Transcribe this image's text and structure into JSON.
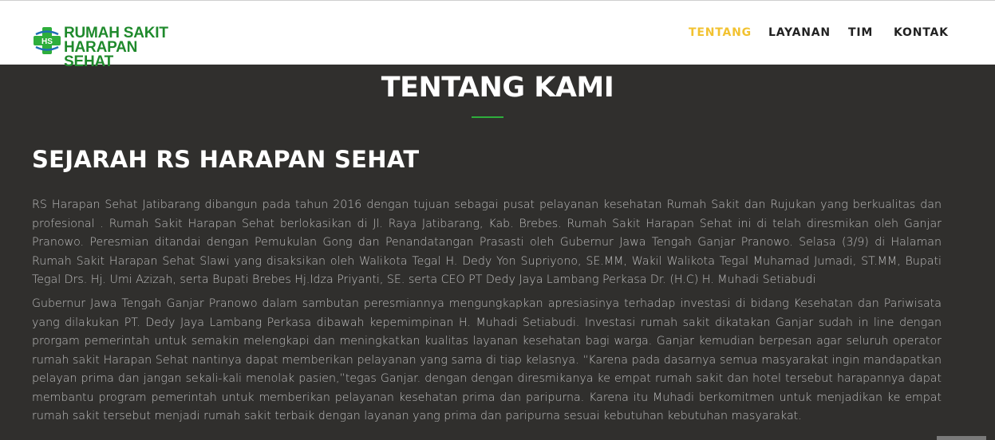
{
  "header": {
    "logo": {
      "line1": "RUMAH SAKIT",
      "line2": "HARAPAN SEHAT",
      "mark": "HS",
      "brand_color": "#1f8a2c"
    },
    "nav": [
      {
        "label": "TENTANG",
        "active": true
      },
      {
        "label": "LAYANAN",
        "active": false
      },
      {
        "label": "TIM",
        "active": false
      },
      {
        "label": "KONTAK",
        "active": false
      }
    ]
  },
  "section": {
    "title": "TENTANG KAMI",
    "heading": "SEJARAH RS HARAPAN SEHAT",
    "paragraphs": [
      "RS Harapan Sehat Jatibarang dibangun pada tahun 2016 dengan tujuan sebagai pusat pelayanan kesehatan Rumah Sakit dan Rujukan yang berkualitas dan profesional . Rumah Sakit Harapan Sehat berlokasikan di Jl. Raya Jatibarang, Kab. Brebes. Rumah Sakit Harapan Sehat ini di telah diresmikan oleh Ganjar Pranowo. Peresmian ditandai dengan Pemukulan Gong dan Penandatangan Prasasti oleh Gubernur Jawa Tengah Ganjar Pranowo. Selasa (3/9) di Halaman Rumah Sakit Harapan Sehat Slawi yang disaksikan oleh Walikota Tegal H. Dedy Yon Supriyono, SE.MM, Wakil Walikota Tegal Muhamad Jumadi, ST.MM, Bupati Tegal Drs. Hj. Umi Azizah, serta Bupati Brebes Hj.Idza Priyanti, SE. serta CEO PT Dedy Jaya Lambang Perkasa Dr. (H.C) H. Muhadi Setiabudi",
      "Gubernur Jawa Tengah Ganjar Pranowo dalam sambutan peresmiannya mengungkapkan apresiasinya terhadap investasi di bidang Kesehatan dan Pariwisata yang dilakukan PT. Dedy Jaya Lambang Perkasa dibawah kepemimpinan H. Muhadi Setiabudi. Investasi rumah sakit dikatakan Ganjar sudah in line dengan prorgam pemerintah untuk semakin melengkapi dan meningkatkan kualitas layanan kesehatan bagi warga. Ganjar kemudian berpesan agar seluruh operator rumah sakit Harapan Sehat nantinya dapat memberikan pelayanan yang sama di tiap kelasnya. “Karena pada dasarnya semua masyarakat ingin mandapatkan pelayan prima dan jangan sekali-kali menolak pasien,”tegas Ganjar. dengan dengan diresmikanya ke empat rumah sakit dan hotel tersebut harapannya dapat membantu program pemerintah untuk memberikan pelayanan kesehatan prima dan paripurna. Karena itu Muhadi berkomitmen untuk menjadikan ke empat rumah sakit tersebut menjadi rumah sakit terbaik dengan layanan yang prima dan paripurna sesuai kebutuhan kebutuhan masyarakat."
    ]
  },
  "colors": {
    "accent": "#f2c230",
    "divider": "#2eae3c",
    "background": "#302f2d"
  }
}
